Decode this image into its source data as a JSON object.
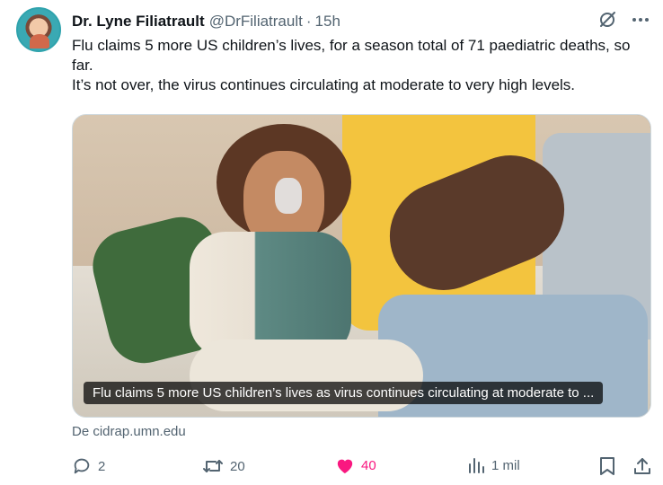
{
  "author": {
    "name": "Dr. Lyne Filiatrault",
    "handle": "@DrFiliatrault",
    "separator": "·",
    "time": "15h"
  },
  "tweet": {
    "line1": "Flu claims 5 more US children’s lives, for a season total  of 71 paediatric deaths, so far.",
    "line2": "It’s not over, the virus continues circulating at moderate to very high levels."
  },
  "media": {
    "caption": "Flu claims 5 more US children’s lives as virus continues circulating at moderate to ..."
  },
  "link": {
    "source": "De cidrap.umn.edu"
  },
  "actions": {
    "replies": "2",
    "reposts": "20",
    "likes": "40",
    "views": "1 mil"
  },
  "colors": {
    "like": "#f91880",
    "muted": "#536471",
    "text": "#0f1419"
  },
  "icons": [
    "grok-slash-icon",
    "more-icon",
    "reply-icon",
    "repost-icon",
    "heart-icon",
    "views-icon",
    "bookmark-icon",
    "share-icon"
  ]
}
